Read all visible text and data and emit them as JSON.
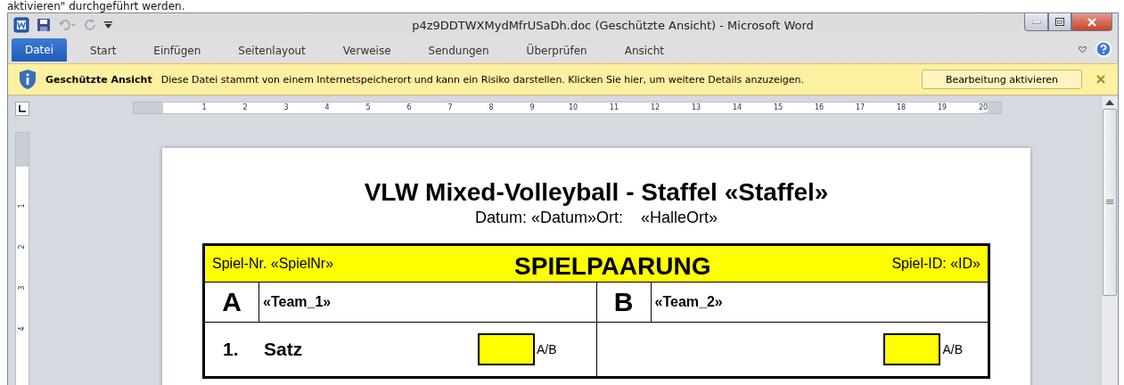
{
  "top_text": "aktivieren\" durchgeführt werden.",
  "window": {
    "title": "p4z9DDTWXMydMfrUSaDh.doc (Geschützte Ansicht)  -  Microsoft Word"
  },
  "ribbon_tabs": [
    {
      "label": "Datei",
      "kind": "file"
    },
    {
      "label": "Start",
      "kind": "tab"
    },
    {
      "label": "Einfügen",
      "kind": "tab"
    },
    {
      "label": "Seitenlayout",
      "kind": "tab"
    },
    {
      "label": "Verweise",
      "kind": "tab"
    },
    {
      "label": "Sendungen",
      "kind": "tab"
    },
    {
      "label": "Überprüfen",
      "kind": "tab"
    },
    {
      "label": "Ansicht",
      "kind": "tab"
    }
  ],
  "message_bar": {
    "title": "Geschützte Ansicht",
    "text": "Diese Datei stammt von einem Internetspeicherort und kann ein Risiko darstellen. Klicken Sie hier, um weitere Details anzuzeigen.",
    "button": "Bearbeitung aktivieren"
  },
  "ruler": {
    "horizontal": [
      "1",
      "2",
      "3",
      "4",
      "5",
      "6",
      "7",
      "8",
      "9",
      "10",
      "11",
      "12",
      "13",
      "14",
      "15",
      "16",
      "17",
      "18",
      "19",
      "20"
    ],
    "vertical": [
      "1",
      "2",
      "3",
      "4"
    ]
  },
  "document": {
    "title": "VLW Mixed-Volleyball - Staffel «Staffel»",
    "subtitle": "Datum: «Datum»Ort:    «HalleOrt»",
    "table": {
      "header": {
        "left": "Spiel-Nr. «SpielNr»",
        "center": "SPIELPAARUNG",
        "right": "Spiel-ID: «ID»"
      },
      "teams": [
        {
          "letter": "A",
          "name": "«Team_1»"
        },
        {
          "letter": "B",
          "name": "«Team_2»"
        }
      ],
      "sets": [
        {
          "number": "1.",
          "label": "Satz",
          "marks": [
            "A/B",
            "A/B"
          ]
        }
      ]
    }
  }
}
